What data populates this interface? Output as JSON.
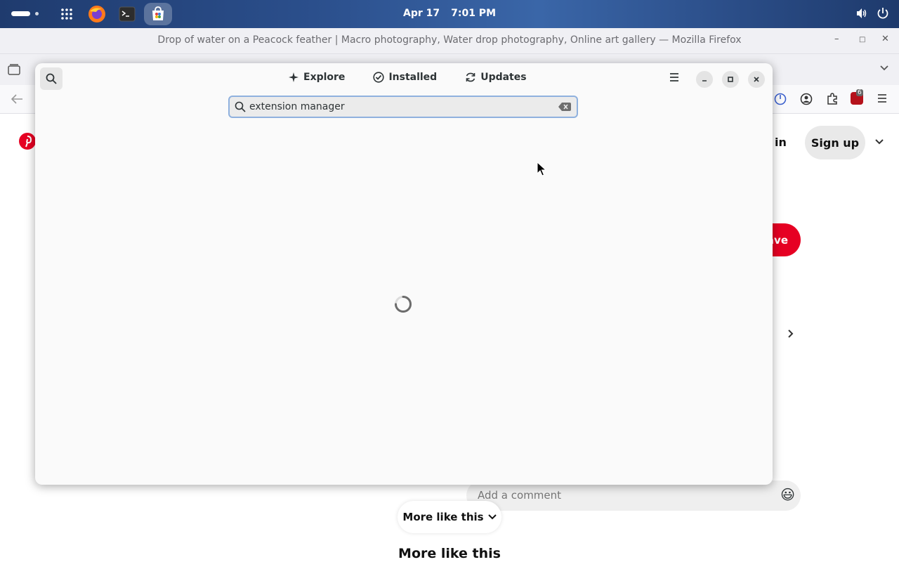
{
  "topbar": {
    "date": "Apr 17",
    "time": "7:01 PM"
  },
  "firefox": {
    "window_title": "Drop of water on a Peacock feather | Macro photography, Water drop photography, Online art gallery — Mozilla Firefox",
    "extension_badge": "6"
  },
  "pinterest": {
    "login_label": "g in",
    "signup_label": "Sign up",
    "save_label": "ave",
    "comment_placeholder": "Add a comment",
    "more_like_this_button": "More like this",
    "more_like_this_heading": "More like this"
  },
  "software": {
    "tabs": [
      {
        "label": "Explore",
        "icon": "sparkle-icon"
      },
      {
        "label": "Installed",
        "icon": "check-circle-icon"
      },
      {
        "label": "Updates",
        "icon": "refresh-icon"
      }
    ],
    "search_value": "extension manager",
    "state": "loading"
  },
  "colors": {
    "pinterest_red": "#e60023",
    "focus_ring": "#8fb1de"
  }
}
